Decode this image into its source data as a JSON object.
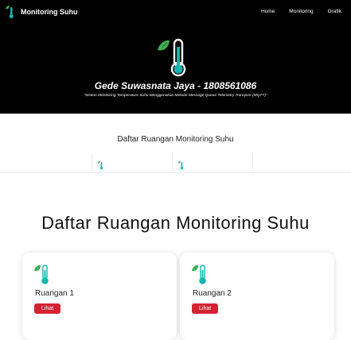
{
  "navbar": {
    "brand": "Monitoring Suhu",
    "links": [
      "Home",
      "Monitoring",
      "Grafik"
    ]
  },
  "hero": {
    "title": "Gede Suwasnata Jaya - 1808561086",
    "subtitle": "\"Sistem Monitoring Temperature Suhu Menggunakan Metode Message Queue Telemetry Transport (MQTT)\""
  },
  "preview": {
    "title": "Daftar Ruangan Monitoring Suhu"
  },
  "main": {
    "title": "Daftar Ruangan Monitoring Suhu",
    "rooms": [
      {
        "name": "Ruangan 1",
        "button": "Lihat"
      },
      {
        "name": "Ruangan 2",
        "button": "Lihat"
      }
    ]
  },
  "colors": {
    "navbar_bg": "#000000",
    "icon_green": "#3fae55",
    "icon_teal": "#11b7b0",
    "button_red": "#d42232"
  },
  "icons": {
    "brand": "thermometer-leaf-icon",
    "room": "thermometer-leaf-icon"
  }
}
